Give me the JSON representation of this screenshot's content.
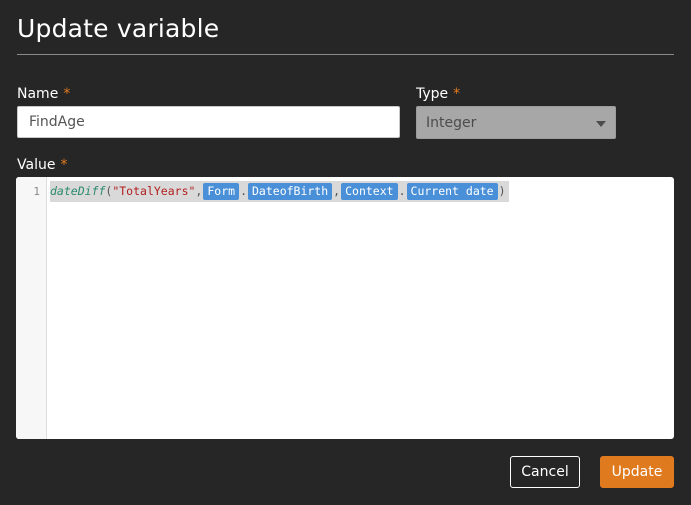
{
  "dialog": {
    "title": "Update variable",
    "required_marker": "*"
  },
  "name_field": {
    "label": "Name",
    "value": "FindAge"
  },
  "type_field": {
    "label": "Type",
    "value": "Integer",
    "disabled": true
  },
  "value_field": {
    "label": "Value",
    "line_number": "1",
    "expression": {
      "function": "dateDiff",
      "open": "(",
      "arg1": "\"TotalYears\"",
      "comma": ",",
      "dot": ".",
      "close": ")",
      "token_form": "Form",
      "token_dob": "DateofBirth",
      "token_context": "Context",
      "token_current_date": "Current date"
    }
  },
  "buttons": {
    "cancel": "Cancel",
    "update": "Update"
  },
  "colors": {
    "background": "#262626",
    "accent": "#e07a1f",
    "token": "#4a90d9"
  }
}
